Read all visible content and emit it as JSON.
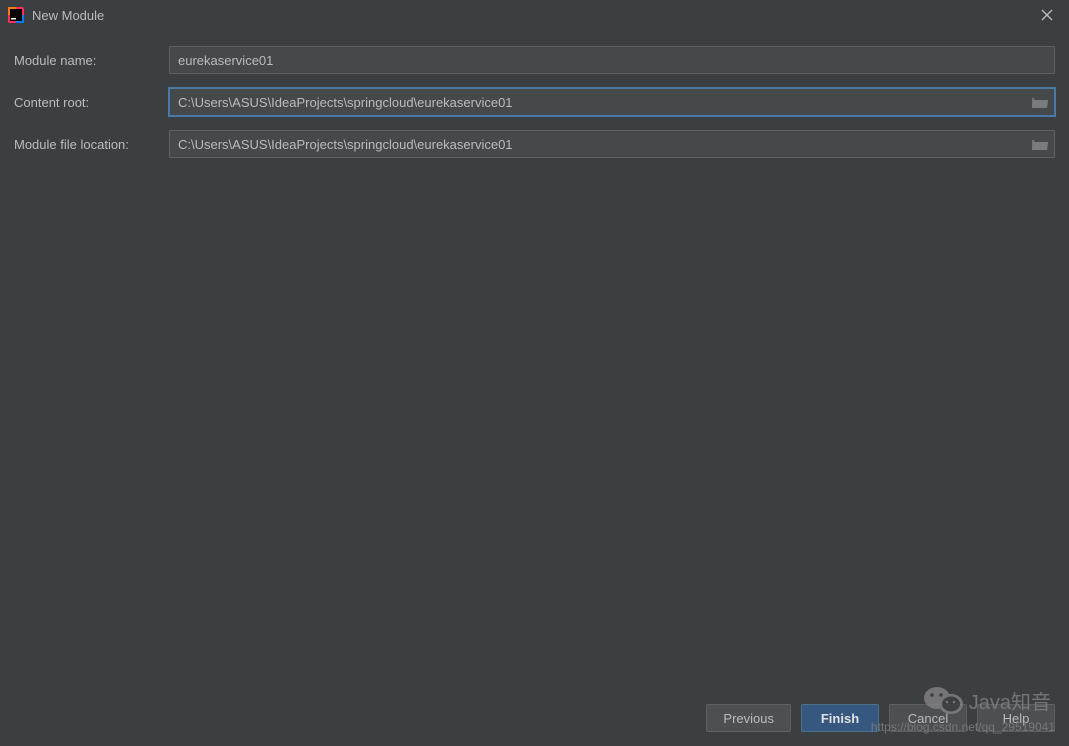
{
  "window": {
    "title": "New Module"
  },
  "form": {
    "moduleName": {
      "label": "Module name:",
      "value": "eurekaservice01"
    },
    "contentRoot": {
      "label": "Content root:",
      "value": "C:\\Users\\ASUS\\IdeaProjects\\springcloud\\eurekaservice01"
    },
    "moduleFileLocation": {
      "label": "Module file location:",
      "value": "C:\\Users\\ASUS\\IdeaProjects\\springcloud\\eurekaservice01"
    }
  },
  "buttons": {
    "previous": "Previous",
    "finish": "Finish",
    "cancel": "Cancel",
    "help": "Help"
  },
  "watermark": {
    "text": "Java知音",
    "url": "https://blog.csdn.net/qq_29519041"
  }
}
